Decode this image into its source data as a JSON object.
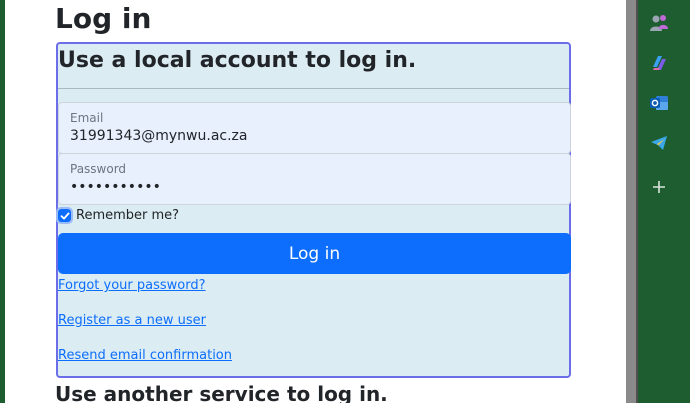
{
  "page": {
    "title": "Log in",
    "section_heading": "Use a local account to log in.",
    "email": {
      "label": "Email",
      "value": "31991343@mynwu.ac.za"
    },
    "password": {
      "label": "Password",
      "value": "•••••••••••"
    },
    "remember": {
      "label": "Remember me?",
      "checked": true
    },
    "login_button": "Log in",
    "links": {
      "forgot": "Forgot your password?",
      "register": "Register as a new user",
      "resend": "Resend email confirmation"
    },
    "other_heading": "Use another service to log in."
  },
  "sidebar": {
    "icons": [
      "people-icon",
      "copilot-icon",
      "outlook-icon",
      "telegram-icon",
      "add-icon"
    ]
  },
  "colors": {
    "primary": "#0d6efd",
    "sidebar_bg": "#1e5d2f",
    "form_bg": "#dbecf2",
    "form_border": "#6b6ee8"
  }
}
